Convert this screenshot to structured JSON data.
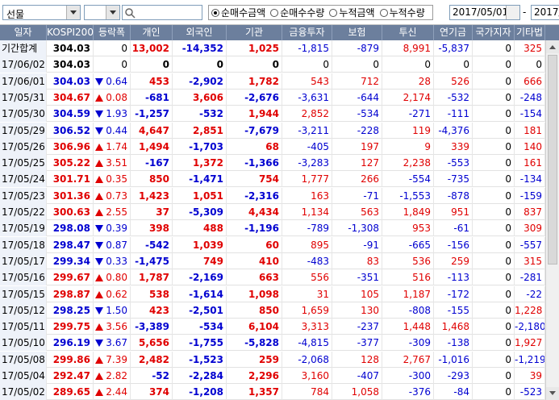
{
  "toolbar": {
    "market_select": "선물",
    "second_select": "",
    "search_value": "",
    "radio_options": [
      {
        "label": "순매수금액",
        "selected": true
      },
      {
        "label": "순매수수량",
        "selected": false
      },
      {
        "label": "누적금액",
        "selected": false
      },
      {
        "label": "누적수량",
        "selected": false
      }
    ],
    "date_from": "2017/05/01",
    "date_sep": "-",
    "date_to": "2017/"
  },
  "table": {
    "columns": [
      "일자",
      "KOSPI200",
      "등락폭",
      "개인",
      "외국인",
      "기관",
      "금융투자",
      "보험",
      "투신",
      "연기금",
      "국가지자체",
      "기타법인"
    ],
    "rows": [
      {
        "date": "기간합계",
        "kospi": "304.03",
        "dir": "",
        "chg": "0",
        "ind": "13,002",
        "frn": "-14,352",
        "inst": "1,025",
        "fin": "-1,815",
        "ins": "-879",
        "inv": "8,991",
        "pen": "-5,837",
        "gov": "0",
        "etc": "325"
      },
      {
        "date": "17/06/02",
        "kospi": "304.03",
        "dir": "",
        "chg": "0",
        "ind": "0",
        "frn": "0",
        "inst": "0",
        "fin": "0",
        "ins": "0",
        "inv": "0",
        "pen": "0",
        "gov": "0",
        "etc": "0"
      },
      {
        "date": "17/06/01",
        "kospi": "304.03",
        "dir": "down",
        "chg": "0.64",
        "ind": "453",
        "frn": "-2,902",
        "inst": "1,782",
        "fin": "543",
        "ins": "712",
        "inv": "28",
        "pen": "526",
        "gov": "0",
        "etc": "666"
      },
      {
        "date": "17/05/31",
        "kospi": "304.67",
        "dir": "up",
        "chg": "0.08",
        "ind": "-681",
        "frn": "3,606",
        "inst": "-2,676",
        "fin": "-3,631",
        "ins": "-644",
        "inv": "2,174",
        "pen": "-532",
        "gov": "0",
        "etc": "-248"
      },
      {
        "date": "17/05/30",
        "kospi": "304.59",
        "dir": "down",
        "chg": "1.93",
        "ind": "-1,257",
        "frn": "-532",
        "inst": "1,944",
        "fin": "2,852",
        "ins": "-534",
        "inv": "-271",
        "pen": "-111",
        "gov": "0",
        "etc": "-154"
      },
      {
        "date": "17/05/29",
        "kospi": "306.52",
        "dir": "down",
        "chg": "0.44",
        "ind": "4,647",
        "frn": "2,851",
        "inst": "-7,679",
        "fin": "-3,211",
        "ins": "-228",
        "inv": "119",
        "pen": "-4,376",
        "gov": "0",
        "etc": "181"
      },
      {
        "date": "17/05/26",
        "kospi": "306.96",
        "dir": "up",
        "chg": "1.74",
        "ind": "1,494",
        "frn": "-1,703",
        "inst": "68",
        "fin": "-405",
        "ins": "197",
        "inv": "9",
        "pen": "339",
        "gov": "0",
        "etc": "140"
      },
      {
        "date": "17/05/25",
        "kospi": "305.22",
        "dir": "up",
        "chg": "3.51",
        "ind": "-167",
        "frn": "1,372",
        "inst": "-1,366",
        "fin": "-3,283",
        "ins": "127",
        "inv": "2,238",
        "pen": "-553",
        "gov": "0",
        "etc": "161"
      },
      {
        "date": "17/05/24",
        "kospi": "301.71",
        "dir": "up",
        "chg": "0.35",
        "ind": "850",
        "frn": "-1,471",
        "inst": "754",
        "fin": "1,777",
        "ins": "266",
        "inv": "-554",
        "pen": "-735",
        "gov": "0",
        "etc": "-134"
      },
      {
        "date": "17/05/23",
        "kospi": "301.36",
        "dir": "up",
        "chg": "0.73",
        "ind": "1,423",
        "frn": "1,051",
        "inst": "-2,316",
        "fin": "163",
        "ins": "-71",
        "inv": "-1,553",
        "pen": "-878",
        "gov": "0",
        "etc": "-159"
      },
      {
        "date": "17/05/22",
        "kospi": "300.63",
        "dir": "up",
        "chg": "2.55",
        "ind": "37",
        "frn": "-5,309",
        "inst": "4,434",
        "fin": "1,134",
        "ins": "563",
        "inv": "1,849",
        "pen": "951",
        "gov": "0",
        "etc": "837"
      },
      {
        "date": "17/05/19",
        "kospi": "298.08",
        "dir": "down",
        "chg": "0.39",
        "ind": "398",
        "frn": "488",
        "inst": "-1,196",
        "fin": "-789",
        "ins": "-1,308",
        "inv": "953",
        "pen": "-61",
        "gov": "0",
        "etc": "309"
      },
      {
        "date": "17/05/18",
        "kospi": "298.47",
        "dir": "down",
        "chg": "0.87",
        "ind": "-542",
        "frn": "1,039",
        "inst": "60",
        "fin": "895",
        "ins": "-91",
        "inv": "-665",
        "pen": "-156",
        "gov": "0",
        "etc": "-557"
      },
      {
        "date": "17/05/17",
        "kospi": "299.34",
        "dir": "down",
        "chg": "0.33",
        "ind": "-1,475",
        "frn": "749",
        "inst": "410",
        "fin": "-483",
        "ins": "83",
        "inv": "536",
        "pen": "259",
        "gov": "0",
        "etc": "315"
      },
      {
        "date": "17/05/16",
        "kospi": "299.67",
        "dir": "up",
        "chg": "0.80",
        "ind": "1,787",
        "frn": "-2,169",
        "inst": "663",
        "fin": "556",
        "ins": "-351",
        "inv": "516",
        "pen": "-113",
        "gov": "0",
        "etc": "-281"
      },
      {
        "date": "17/05/15",
        "kospi": "298.87",
        "dir": "up",
        "chg": "0.62",
        "ind": "538",
        "frn": "-1,614",
        "inst": "1,098",
        "fin": "31",
        "ins": "105",
        "inv": "1,187",
        "pen": "-172",
        "gov": "0",
        "etc": "-22"
      },
      {
        "date": "17/05/12",
        "kospi": "298.25",
        "dir": "down",
        "chg": "1.50",
        "ind": "423",
        "frn": "-2,501",
        "inst": "850",
        "fin": "1,659",
        "ins": "130",
        "inv": "-808",
        "pen": "-155",
        "gov": "0",
        "etc": "1,228"
      },
      {
        "date": "17/05/11",
        "kospi": "299.75",
        "dir": "up",
        "chg": "3.56",
        "ind": "-3,389",
        "frn": "-534",
        "inst": "6,104",
        "fin": "3,313",
        "ins": "-237",
        "inv": "1,448",
        "pen": "1,468",
        "gov": "0",
        "etc": "-2,180"
      },
      {
        "date": "17/05/10",
        "kospi": "296.19",
        "dir": "down",
        "chg": "3.67",
        "ind": "5,656",
        "frn": "-1,755",
        "inst": "-5,828",
        "fin": "-4,815",
        "ins": "-377",
        "inv": "-309",
        "pen": "-138",
        "gov": "0",
        "etc": "1,927"
      },
      {
        "date": "17/05/08",
        "kospi": "299.86",
        "dir": "up",
        "chg": "7.39",
        "ind": "2,482",
        "frn": "-1,523",
        "inst": "259",
        "fin": "-2,068",
        "ins": "128",
        "inv": "2,767",
        "pen": "-1,016",
        "gov": "0",
        "etc": "-1,219"
      },
      {
        "date": "17/05/04",
        "kospi": "292.47",
        "dir": "up",
        "chg": "2.82",
        "ind": "-52",
        "frn": "-2,284",
        "inst": "2,296",
        "fin": "3,160",
        "ins": "-407",
        "inv": "-300",
        "pen": "-293",
        "gov": "0",
        "etc": "39"
      },
      {
        "date": "17/05/02",
        "kospi": "289.65",
        "dir": "up",
        "chg": "2.44",
        "ind": "374",
        "frn": "-1,208",
        "inst": "1,357",
        "fin": "784",
        "ins": "1,058",
        "inv": "-376",
        "pen": "-84",
        "gov": "0",
        "etc": "-523"
      }
    ]
  },
  "colors": {
    "header_bg": "#6c7f9d",
    "positive": "#e00000",
    "negative": "#0000d0",
    "date_bg": "#eef2f9"
  },
  "icons": {
    "search": "search-icon",
    "calendar": "calendar-icon",
    "dropdown": "chevron-down-icon"
  }
}
